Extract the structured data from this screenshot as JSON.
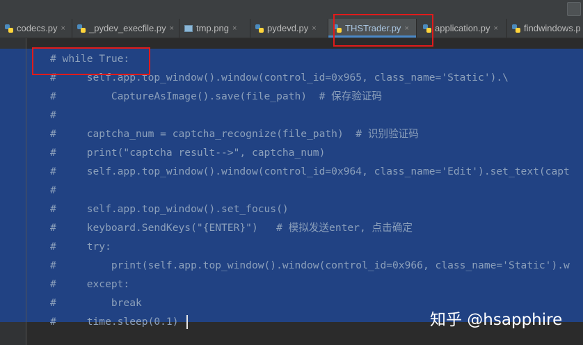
{
  "tabs": [
    {
      "label": "codecs.py",
      "icon": "python-file-icon",
      "active": false
    },
    {
      "label": "_pydev_execfile.py",
      "icon": "python-file-icon",
      "active": false
    },
    {
      "label": "tmp.png",
      "icon": "image-file-icon",
      "active": false
    },
    {
      "label": "pydevd.py",
      "icon": "python-file-icon",
      "active": false
    },
    {
      "label": "THSTrader.py",
      "icon": "python-file-icon",
      "active": true
    },
    {
      "label": "application.py",
      "icon": "python-file-icon",
      "active": false
    },
    {
      "label": "findwindows.p",
      "icon": "python-file-icon",
      "active": false
    }
  ],
  "close_glyph": "×",
  "code_lines": [
    "# while True:",
    "#     self.app.top_window().window(control_id=0x965, class_name='Static').\\",
    "#         CaptureAsImage().save(file_path)  # 保存验证码",
    "#",
    "#     captcha_num = captcha_recognize(file_path)  # 识别验证码",
    "#     print(\"captcha result-->\", captcha_num)",
    "#     self.app.top_window().window(control_id=0x964, class_name='Edit').set_text(capt",
    "#",
    "#     self.app.top_window().set_focus()",
    "#     keyboard.SendKeys(\"{ENTER}\")   # 模拟发送enter, 点击确定",
    "#     try:",
    "#         print(self.app.top_window().window(control_id=0x966, class_name='Static').w",
    "#     except:",
    "#         break",
    "#     time.sleep(0.1)"
  ],
  "watermark": "知乎 @hsapphire",
  "colors": {
    "selection": "#214283",
    "highlight_box": "#e01b1b",
    "active_tab_underline": "#4a88c7"
  }
}
